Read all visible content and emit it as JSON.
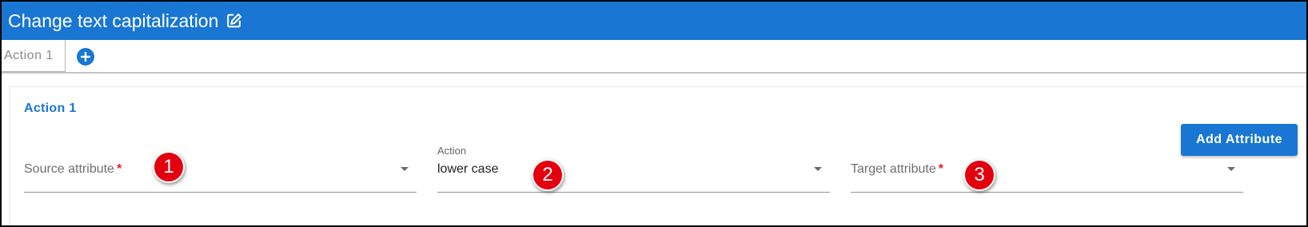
{
  "header": {
    "title": "Change text capitalization",
    "edit_icon": "edit-icon"
  },
  "tabs": [
    {
      "label": "Action 1",
      "selected": true
    }
  ],
  "add_tab_icon": "plus-circle-icon",
  "section": {
    "title": "Action 1",
    "add_attribute_label": "Add Attribute"
  },
  "fields": {
    "source": {
      "placeholder": "Source attribute",
      "required_mark": "*",
      "value": ""
    },
    "action": {
      "label": "Action",
      "value": "lower case"
    },
    "target": {
      "placeholder": "Target attribute",
      "required_mark": "*",
      "value": ""
    }
  },
  "badges": [
    "1",
    "2",
    "3"
  ],
  "colors": {
    "accent": "#1976d2",
    "badge": "#e3000f",
    "required": "#e02020"
  }
}
